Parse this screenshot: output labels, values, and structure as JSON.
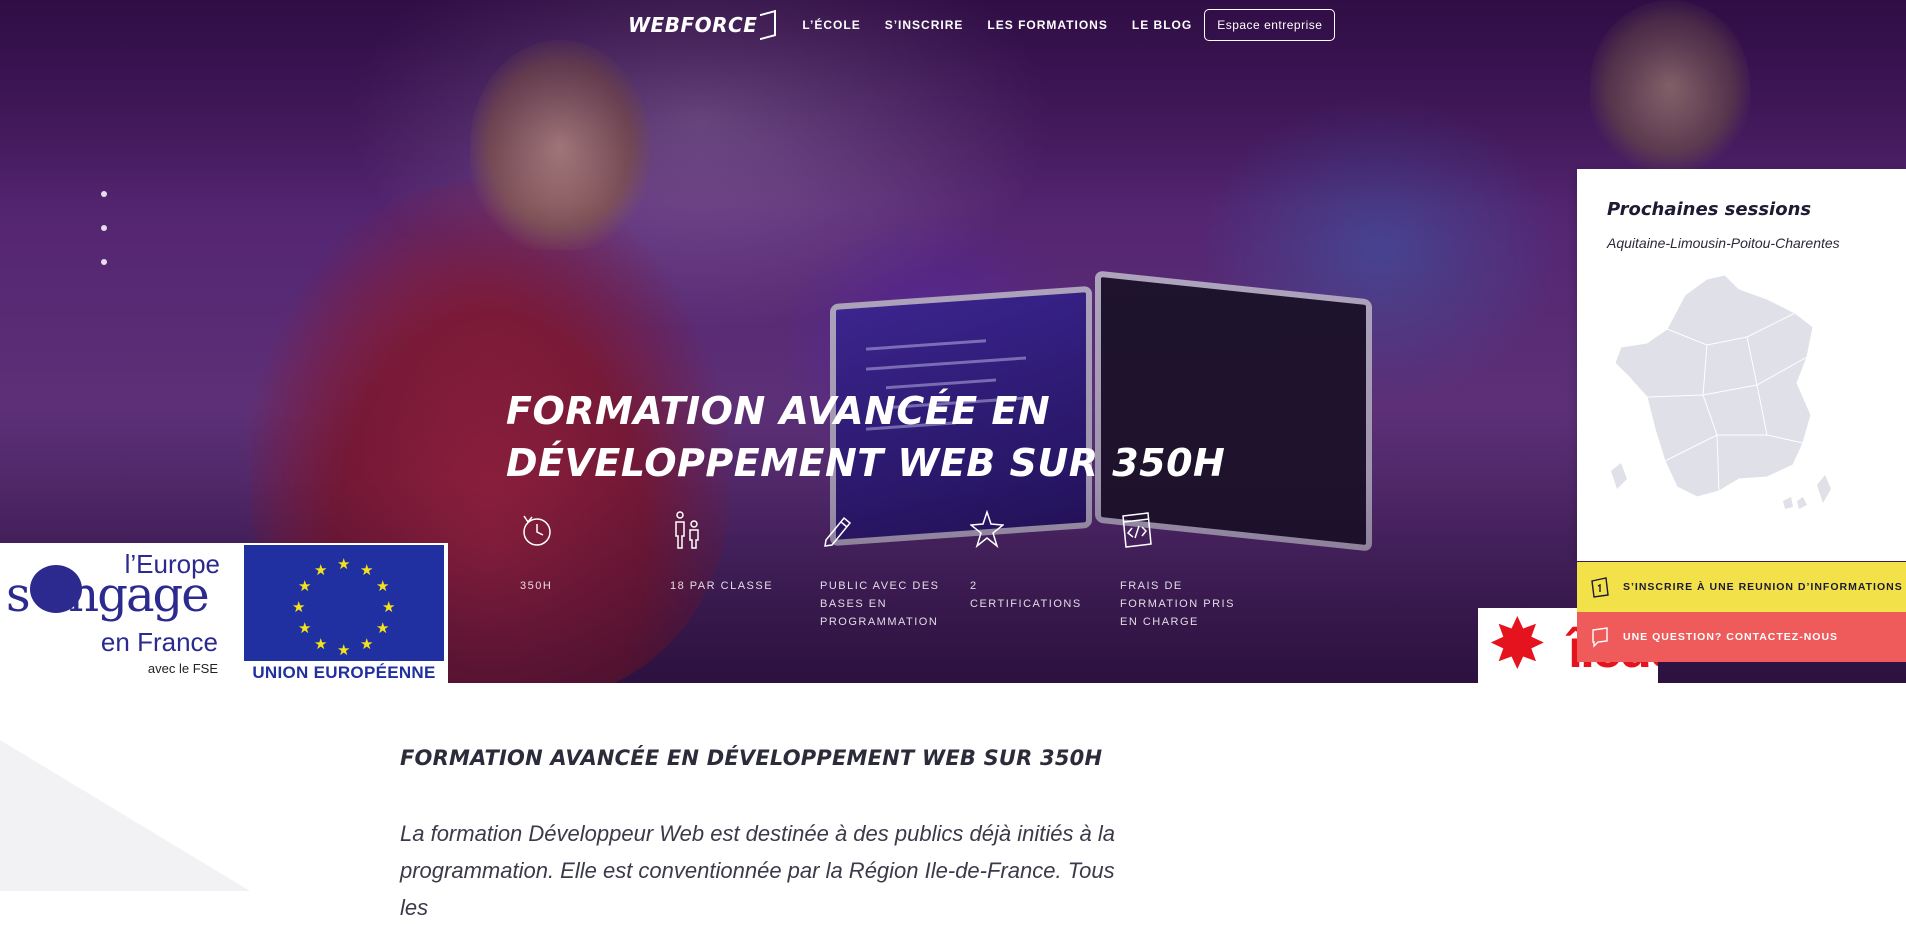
{
  "nav": {
    "logo": "WEBFORCE",
    "items": [
      {
        "label": "L’ÉCOLE"
      },
      {
        "label": "S’INSCRIRE"
      },
      {
        "label": "LES FORMATIONS"
      },
      {
        "label": "LE BLOG"
      }
    ],
    "cta": "Espace entreprise"
  },
  "hero": {
    "title_line1": "FORMATION AVANCÉE EN",
    "title_line2": "DÉVELOPPEMENT WEB SUR 350H",
    "features": [
      {
        "icon": "clock-icon",
        "label": "350H"
      },
      {
        "icon": "people-icon",
        "label": "18 PAR CLASSE"
      },
      {
        "icon": "pencil-icon",
        "label": "PUBLIC AVEC DES BASES EN PROGRAMMATION"
      },
      {
        "icon": "star-icon",
        "label": "2 CERTIFICATIONS"
      },
      {
        "icon": "code-icon",
        "label": "FRAIS DE FORMATION PRIS EN CHARGE"
      }
    ]
  },
  "eu": {
    "europe": "l’Europe",
    "engage": "s’engage",
    "france": "en France",
    "fse": "avec le FSE",
    "union": "UNION EUROPÉENNE"
  },
  "idf": {
    "text": "îledeFrance"
  },
  "sessions": {
    "title": "Prochaines sessions",
    "region": "Aquitaine-Limousin-Poitou-Charentes",
    "cta_info": "S’INSCRIRE À UNE REUNION D’INFORMATIONS",
    "cta_contact": "UNE QUESTION? CONTACTEZ-NOUS"
  },
  "content": {
    "title": "FORMATION AVANCÉE EN DÉVELOPPEMENT WEB SUR 350H",
    "intro": "La formation Développeur Web est destinée à des publics déjà initiés à la programmation. Elle est conventionnée par la Région Ile-de-France. Tous les"
  },
  "colors": {
    "cta_yellow": "#f3e14a",
    "cta_red": "#ef5a5a",
    "eu_blue": "#2130a0",
    "idf_red": "#e5131d"
  }
}
